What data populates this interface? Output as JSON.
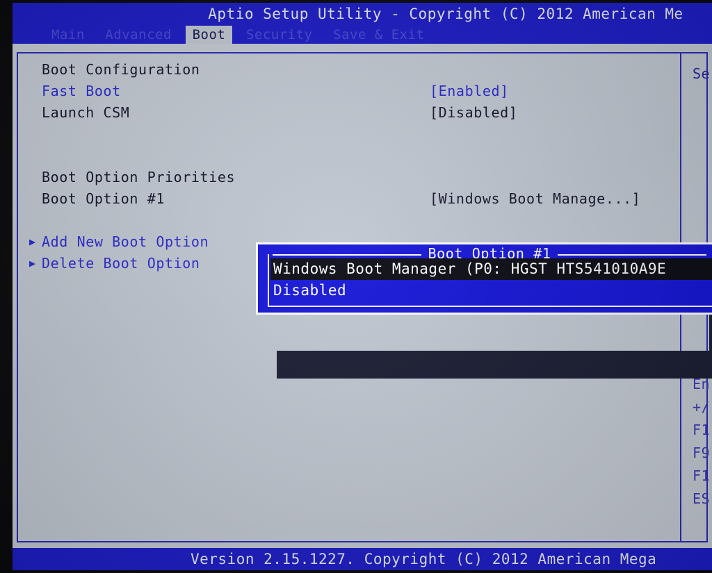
{
  "window": {
    "title": "Aptio Setup Utility - Copyright (C) 2012 American Me",
    "status": "Version 2.15.1227. Copyright (C) 2012 American Mega"
  },
  "menubar": {
    "tabs": [
      {
        "label": "Main",
        "active": false
      },
      {
        "label": "Advanced",
        "active": false
      },
      {
        "label": "Boot",
        "active": true
      },
      {
        "label": "Security",
        "active": false
      },
      {
        "label": "Save & Exit",
        "active": false
      }
    ]
  },
  "settings": {
    "section_boot_configuration": "Boot Configuration",
    "rows": [
      {
        "label": "Fast Boot",
        "value": "[Enabled]",
        "color": "blue"
      },
      {
        "label": "Launch CSM",
        "value": "[Disabled]",
        "color": "dark"
      }
    ],
    "section_boot_option_priorities": "Boot Option Priorities",
    "boot_option_1": {
      "label": "Boot Option #1",
      "value": "[Windows Boot Manage...]"
    },
    "actions": [
      {
        "marker": "▶",
        "label": "Add New Boot Option"
      },
      {
        "marker": "▶",
        "label": "Delete Boot Option"
      }
    ]
  },
  "help": {
    "description": "Se",
    "keys": [
      "En",
      "+/",
      "F1",
      "F9",
      "F1",
      "ES"
    ]
  },
  "popup": {
    "title": "Boot Option #1",
    "options": [
      {
        "label": "Windows Boot Manager (P0: HGST HTS541010A9E",
        "selected": true
      },
      {
        "label": "Disabled",
        "selected": false
      }
    ]
  },
  "colors": {
    "titlebar_blue": "#1d1dc8",
    "panel_silver": "#c5cbd4",
    "accent_blue": "#2a2ad0",
    "text_dark": "#15152e",
    "popup_blue": "#1515d8",
    "selection_black": "#0b0b14"
  }
}
